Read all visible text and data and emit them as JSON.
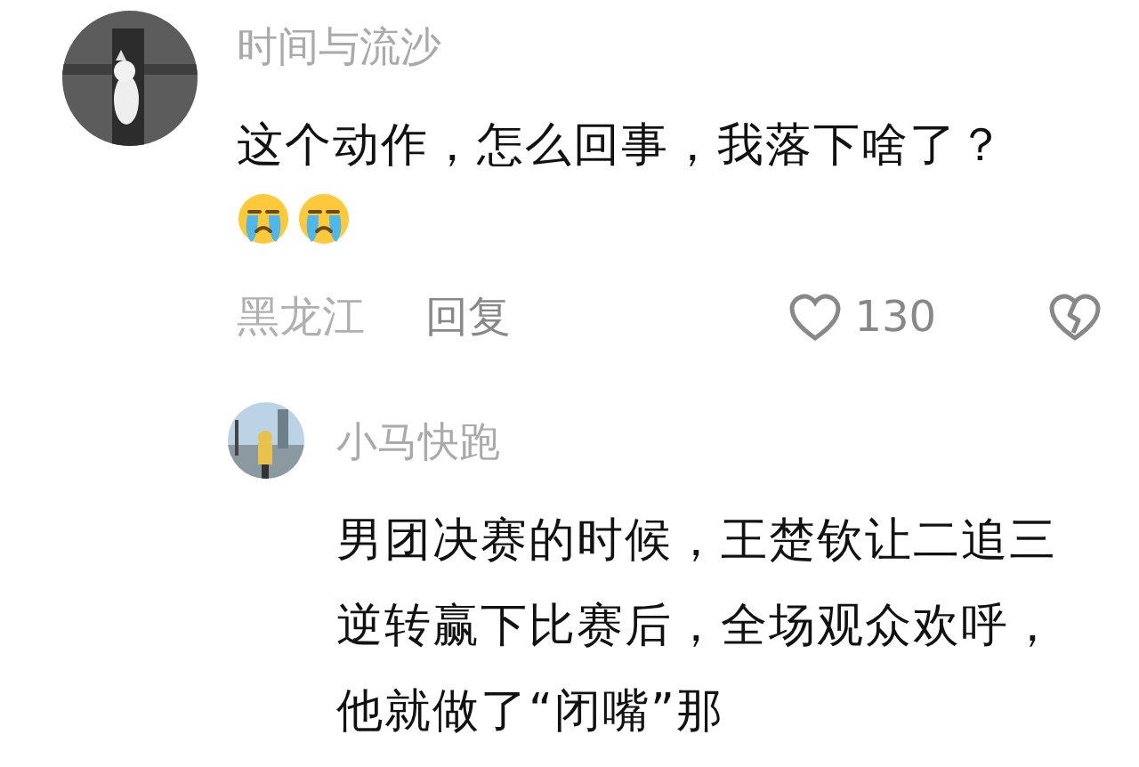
{
  "comment": {
    "username": "时间与流沙",
    "text": "这个动作，怎么回事，我落下啥了？",
    "location": "黑龙江",
    "reply_label": "回复",
    "likes": "130"
  },
  "reply": {
    "username": "小马快跑",
    "text": "男团决赛的时候，王楚钦让二追三逆转赢下比赛后，全场观众欢呼，他就做了“闭嘴”那"
  }
}
